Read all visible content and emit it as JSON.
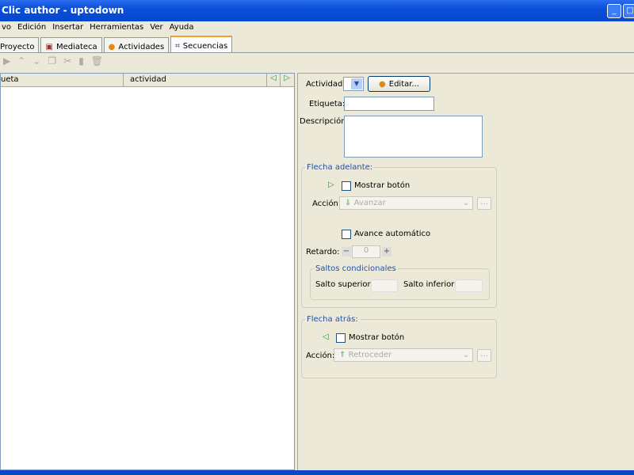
{
  "window": {
    "title": "Clic author - uptodown"
  },
  "menu": [
    "vo",
    "Edición",
    "Insertar",
    "Herramientas",
    "Ver",
    "Ayuda"
  ],
  "tabs": [
    {
      "label": "Proyecto",
      "icon": "project-icon"
    },
    {
      "label": "Mediateca",
      "icon": "media-icon"
    },
    {
      "label": "Actividades",
      "icon": "activity-icon"
    },
    {
      "label": "Secuencias",
      "icon": "sequence-icon",
      "active": true
    }
  ],
  "list": {
    "col1": "ueta",
    "col2": "actividad"
  },
  "form": {
    "actividad_label": "Actividad:",
    "editar_label": "Editar...",
    "etiqueta_label": "Etiqueta:",
    "etiqueta_value": "",
    "descripcion_label": "Descripción:",
    "descripcion_value": "",
    "forward": {
      "title": "Flecha adelante:",
      "mostrar": "Mostrar botón",
      "accion_label": "Acción:",
      "accion_value": "Avanzar",
      "auto": "Avance automático",
      "retardo_label": "Retardo:",
      "retardo_value": "0",
      "saltos": {
        "title": "Saltos condicionales",
        "superior": "Salto superior:",
        "inferior": "Salto inferior:"
      }
    },
    "back": {
      "title": "Flecha atrás:",
      "mostrar": "Mostrar botón",
      "accion_label": "Acción:",
      "accion_value": "Retroceder"
    },
    "dots": "..."
  }
}
